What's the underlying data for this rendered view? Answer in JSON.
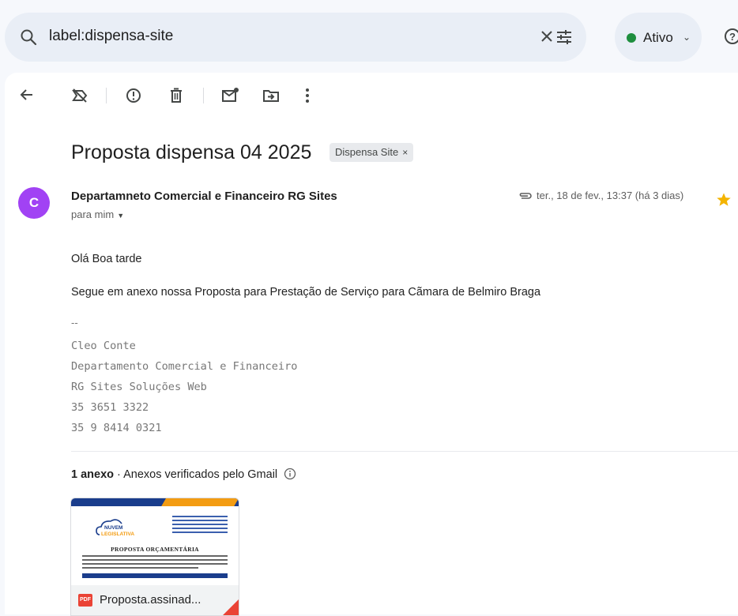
{
  "search": {
    "query": "label:dispensa-site"
  },
  "status": {
    "label": "Ativo"
  },
  "toolbar": {
    "icons": [
      "back-icon",
      "mark-not-important-icon",
      "report-spam-icon",
      "delete-icon",
      "mark-unread-icon",
      "move-to-icon",
      "more-icon"
    ]
  },
  "email": {
    "subject": "Proposta dispensa 04 2025",
    "label": "Dispensa Site",
    "avatar_letter": "C",
    "sender": "Departamneto Comercial e Financeiro RG Sites",
    "to": "para mim",
    "date": "ter., 18 de fev., 13:37 (há 3 dias)",
    "greeting": "Olá Boa tarde",
    "body": "Segue em anexo nossa Proposta para Prestação de Serviço para Cãmara de Belmiro Braga",
    "sig_dash": "--",
    "signature": [
      "Cleo Conte",
      "Departamento Comercial e Financeiro",
      "RG Sites Soluções Web",
      "35 3651 3322",
      "35 9 8414 0321"
    ]
  },
  "attachments": {
    "count_label": "1 anexo",
    "separator": "·",
    "verified_text": "Anexos verificados pelo Gmail",
    "file": {
      "type_badge": "PDF",
      "name": "Proposta.assinad...",
      "preview_title": "PROPOSTA ORÇAMENTÁRIA",
      "logo_line1": "NUVEM",
      "logo_line2": "LEGISLATIVA"
    }
  },
  "colors": {
    "avatar": "#a142f4",
    "status_dot": "#1e8e3e",
    "star": "#f4b400",
    "pdf": "#ea4335"
  }
}
